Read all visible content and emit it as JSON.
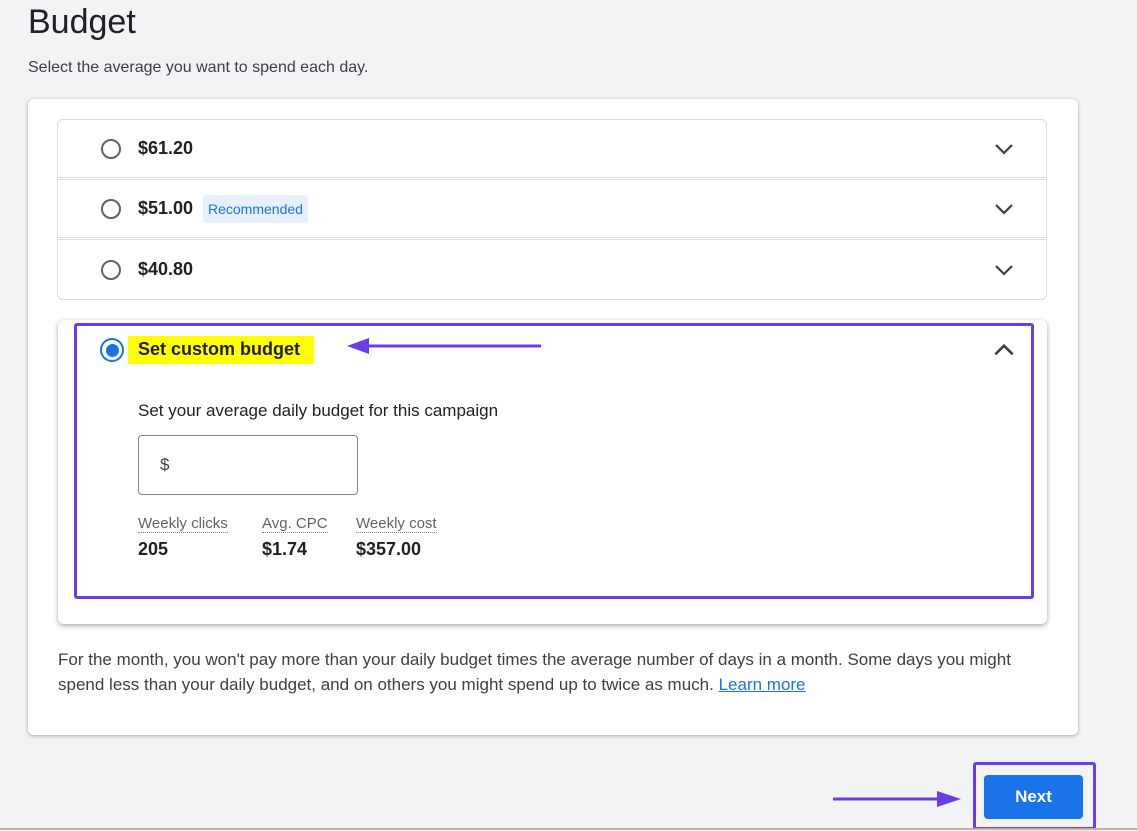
{
  "header": {
    "title": "Budget",
    "subtitle": "Select the average you want to spend each day."
  },
  "options": [
    {
      "label": "$61.20",
      "selected": false
    },
    {
      "label": "$51.00",
      "badge": "Recommended",
      "selected": false
    },
    {
      "label": "$40.80",
      "selected": false
    }
  ],
  "custom": {
    "label": "Set custom budget",
    "selected": true,
    "prompt": "Set your average daily budget for this campaign",
    "input_prefix": "$",
    "input_value": "",
    "metrics": [
      {
        "label": "Weekly clicks",
        "value": "205"
      },
      {
        "label": "Avg. CPC",
        "value": "$1.74"
      },
      {
        "label": "Weekly cost",
        "value": "$357.00"
      }
    ]
  },
  "footer": {
    "text": "For the month, you won't pay more than your daily budget times the average number of days in a month. Some days you might spend less than your daily budget, and on others you might spend up to twice as much. ",
    "link": "Learn more"
  },
  "actions": {
    "next_label": "Next"
  },
  "colors": {
    "accent": "#1a73e8",
    "annotation": "#6a3de8",
    "highlight": "#ffff00",
    "badge_bg": "#e8f0fe"
  },
  "icons": {
    "collapsed": "chevron-down-icon",
    "expanded": "chevron-up-icon",
    "annotation": "arrow-icon"
  }
}
